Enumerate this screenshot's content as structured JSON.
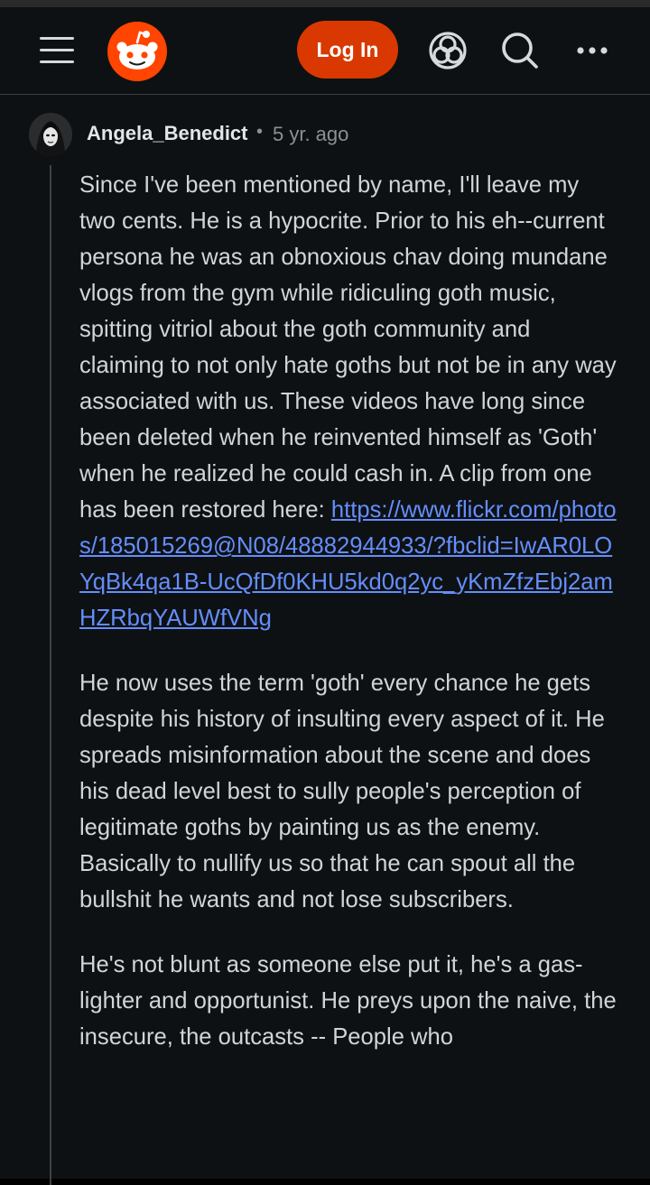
{
  "header": {
    "login_label": "Log In",
    "icons": [
      "menu-icon",
      "reddit-logo",
      "popular-icon",
      "search-icon",
      "more-icon"
    ],
    "colors": {
      "background": "#0e1113",
      "login": "#d93900",
      "logo": "#ff4500"
    }
  },
  "comment": {
    "author": "Angela_Benedict",
    "separator": "•",
    "time": "5 yr. ago",
    "p1_text": "Since I've been mentioned by name, I'll leave my two cents. He is a hypocrite. Prior to his eh--current persona he was an obnoxious chav doing mundane vlogs from the gym while ridiculing goth music, spitting vitriol about the goth community and claiming to not only hate goths but not be in any way associated with us. These videos have long since been deleted when he reinvented himself as 'Goth' when he realized he could cash in. A clip from one has been restored here: ",
    "p1_link": "https://www.flickr.com/photos/185015269@N08/48882944933/?fbclid=IwAR0LOYqBk4qa1B-UcQfDf0KHU5kd0q2yc_yKmZfzEbj2amHZRbqYAUWfVNg",
    "p2": "He now uses the term 'goth' every chance he gets despite his history of insulting every aspect of it. He spreads misinformation about the scene and does his dead level best to sully people's perception of legitimate goths by painting us as the enemy. Basically to nullify us so that he can spout all the bullshit he wants and not lose subscribers.",
    "p3": "He's not blunt as someone else put it, he's a gas-lighter and opportunist. He preys upon the naive, the insecure, the outcasts -- People who",
    "colors": {
      "text": "#d2d5d7",
      "link": "#648efc",
      "meta": "#8c9093"
    }
  }
}
